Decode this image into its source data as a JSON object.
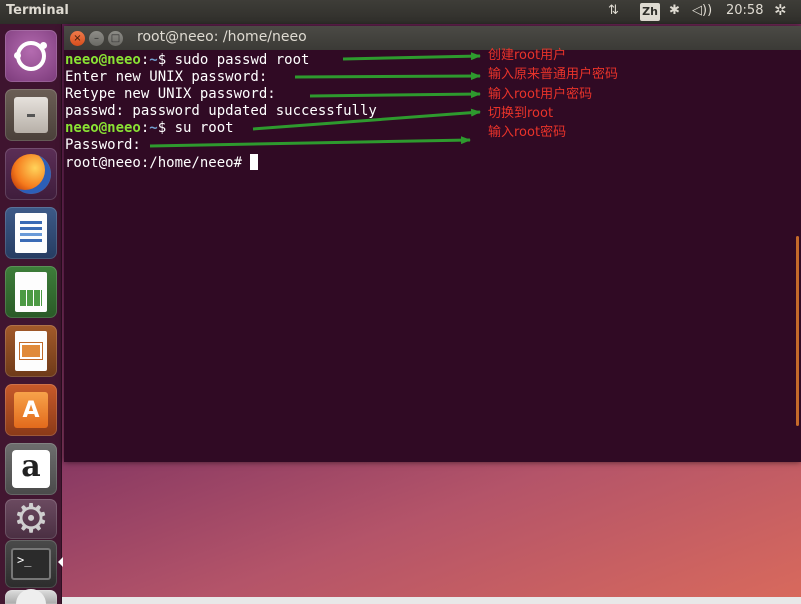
{
  "top_panel": {
    "app_title": "Terminal",
    "network_glyph": "⇅",
    "keyboard_layout": "Zh",
    "bluetooth_glyph": "✱",
    "volume_glyph": "◁))",
    "clock": "20:58",
    "gear_glyph": "✲"
  },
  "launcher": {
    "items": [
      "dash-home",
      "files",
      "firefox",
      "libreoffice-writer",
      "libreoffice-calc",
      "libreoffice-impress",
      "ubuntu-software",
      "amazon",
      "system-settings",
      "terminal",
      "disc"
    ],
    "software_letter": "A",
    "amazon_letter": "a",
    "terminal_prompt": ">_"
  },
  "window": {
    "title": "root@neeo: /home/neeo",
    "close_glyph": "×",
    "min_glyph": "–",
    "max_glyph": "□"
  },
  "terminal": {
    "line1": {
      "user": "neeo@neeo",
      "sep": ":",
      "path": "~",
      "rest": "$ sudo passwd root"
    },
    "line2": "Enter new UNIX password:",
    "line3": "Retype new UNIX password:",
    "line4": "passwd: password updated successfully",
    "line5": {
      "user": "neeo@neeo",
      "sep": ":",
      "path": "~",
      "rest": "$ su root"
    },
    "line6": "Password:",
    "line7": "root@neeo:/home/neeo# "
  },
  "annotations": {
    "a1": "创建root用户",
    "a2": "输入原来普通用户密码",
    "a3": "输入root用户密码",
    "a4": "切换到root",
    "a5": "输入root密码",
    "arrow_color": "#2e9a2e",
    "label_color": "#e8332a"
  }
}
